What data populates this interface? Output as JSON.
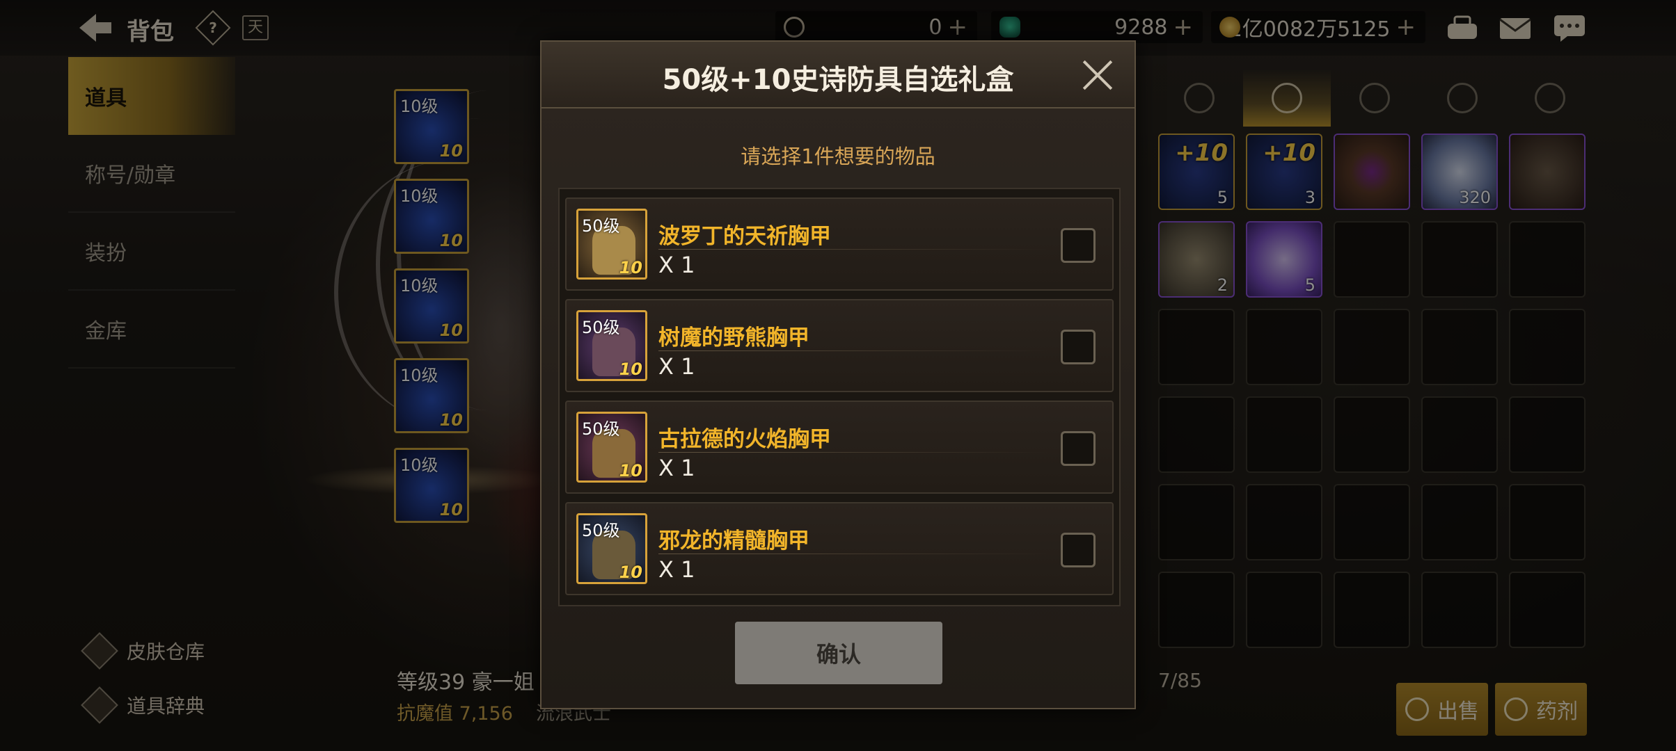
{
  "header": {
    "title": "背包",
    "help_label": "?",
    "calendar_label": "天",
    "currencies": [
      {
        "name": "cera",
        "value": "0",
        "icon": "coin-c-icon"
      },
      {
        "name": "gem",
        "value": "9288",
        "icon": "green-gem-icon"
      },
      {
        "name": "gold",
        "value": "1亿0082万5125",
        "icon": "gold-coin-icon"
      }
    ],
    "plus_symbol": "+"
  },
  "sidebar": {
    "items": [
      {
        "label": "道具",
        "active": true
      },
      {
        "label": "称号/勋章",
        "active": false
      },
      {
        "label": "装扮",
        "active": false
      },
      {
        "label": "金库",
        "active": false
      }
    ],
    "bottom_links": [
      {
        "label": "皮肤仓库",
        "icon": "skin-warehouse-icon"
      },
      {
        "label": "道具辞典",
        "icon": "item-dictionary-icon"
      }
    ]
  },
  "equipped": {
    "slots": [
      {
        "level": "10级",
        "enhance": "10"
      },
      {
        "level": "10级",
        "enhance": "10"
      },
      {
        "level": "10级",
        "enhance": "10"
      },
      {
        "level": "10级",
        "enhance": "10"
      },
      {
        "level": "10级",
        "enhance": "10"
      }
    ]
  },
  "character": {
    "name_line": "等级39 豪一姐",
    "stat_line": "抗魔值 7,156",
    "class_line": "流浪武士"
  },
  "inventory": {
    "tabs": [
      "armor-tab-icon",
      "consumable-tab-icon",
      "material-tab-icon",
      "card-tab-icon",
      "star-tab-icon"
    ],
    "active_tab": 1,
    "capacity": "7/85",
    "items": [
      {
        "tag": "+10",
        "count": "5",
        "style": "filled",
        "color": "#1d2a63"
      },
      {
        "tag": "+10",
        "count": "3",
        "style": "filled",
        "color": "#1d2a63"
      },
      {
        "tag": "",
        "count": "",
        "style": "purple",
        "color": "#5b3a28"
      },
      {
        "tag": "",
        "count": "320",
        "style": "purple",
        "color": "#8fa3c7"
      },
      {
        "tag": "",
        "count": "",
        "style": "purple",
        "color": "#3a2a24"
      },
      {
        "tag": "",
        "count": "2",
        "style": "purple",
        "color": "#4a4438"
      },
      {
        "tag": "",
        "count": "5",
        "style": "purple",
        "color": "#7a4fc2"
      }
    ],
    "sell_label": "出售",
    "potion_label": "药剂"
  },
  "modal": {
    "title": "50级+10史诗防具自选礼盒",
    "subtitle": "请选择1件想要的物品",
    "options": [
      {
        "level": "50级",
        "enhance": "10",
        "name": "波罗丁的天祈胸甲",
        "qty": "X 1",
        "color": "#8a6a3a"
      },
      {
        "level": "50级",
        "enhance": "10",
        "name": "树魔的野熊胸甲",
        "qty": "X 1",
        "color": "#5e3c6e"
      },
      {
        "level": "50级",
        "enhance": "10",
        "name": "古拉德的火焰胸甲",
        "qty": "X 1",
        "color": "#6e3a5a"
      },
      {
        "level": "50级",
        "enhance": "10",
        "name": "邪龙的精髓胸甲",
        "qty": "X 1",
        "color": "#3a4a6a"
      }
    ],
    "confirm_label": "确认"
  }
}
